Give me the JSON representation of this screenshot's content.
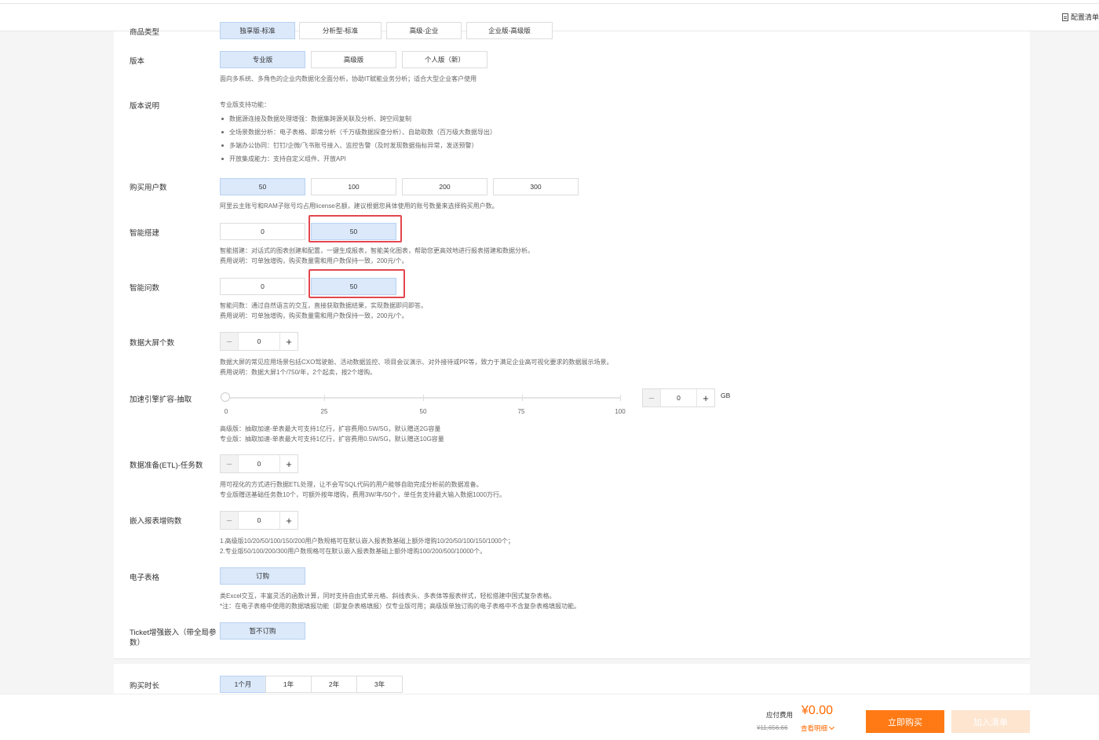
{
  "topbar": {
    "config_label": "配置清单"
  },
  "config": {
    "product_type": {
      "label": "商品类型",
      "options": [
        "独享版-标准",
        "分析型-标准",
        "高级-企业",
        "企业版-高级版"
      ]
    },
    "edition": {
      "label": "版本",
      "options": [
        "专业版",
        "高级版",
        "个人版（新）"
      ],
      "selected": "专业版",
      "desc": "面向多系统、多角色的企业内数据化全面分析，协助IT赋能业务分析；适合大型企业客户使用"
    },
    "edition_desc": {
      "label": "版本说明",
      "intro": "专业版支持功能：",
      "features": [
        "数据源连接及数据处理增强：数据集跨源关联及分析、跨空间复制",
        "全场景数据分析：电子表格、即席分析（千万级数据探查分析）、自助取数（百万级大数据导出）",
        "多端办公协同：钉钉/企微/飞书账号接入、监控告警（及时发现数据指标异常，发送预警）",
        "开放集成能力：支持自定义组件、开放API"
      ]
    },
    "users": {
      "label": "购买用户数",
      "options": [
        "50",
        "100",
        "200",
        "300"
      ],
      "selected": "50",
      "desc": "阿里云主账号和RAM子账号均占用license名额，建议根据您具体使用的账号数量来选择购买用户数。"
    },
    "smart_build": {
      "label": "智能搭建",
      "options": [
        "0",
        "50"
      ],
      "selected": "50",
      "desc1": "智能搭建：对话式的图表创建和配置，一键生成报表，智能美化图表，帮助您更高效地进行报表搭建和数据分析。",
      "desc2": "费用说明：可单独增购，购买数量需和用户数保持一致，200元/个。"
    },
    "smart_qa": {
      "label": "智能问数",
      "options": [
        "0",
        "50"
      ],
      "selected": "50",
      "desc1": "智能问数：通过自然语言的交互，直接获取数据结果，实现数据即问即答。",
      "desc2": "费用说明：可单独增购，购买数量需和用户数保持一致，200元/个。"
    },
    "big_screen": {
      "label": "数据大屏个数",
      "value": "0",
      "desc1": "数据大屏的常见应用场景包括CXO驾驶舱、活动数据监控、项目会议演示、对外接待或PR等，致力于满足企业高可视化要求的数据展示场景。",
      "desc2": "费用说明：数据大屏1个/750/年，2个起卖，按2个增购。"
    },
    "engine": {
      "label": "加速引擎扩容-抽取",
      "slider_value": 0,
      "ticks": [
        "0",
        "25",
        "50",
        "75",
        "100"
      ],
      "value": "0",
      "unit": "GB",
      "desc1": "高级版：抽取加速-单表最大可支持1亿行，扩容费用0.5W/5G，默认赠送2G容量",
      "desc2": "专业版：抽取加速-单表最大可支持1亿行，扩容费用0.5W/5G，默认赠送10G容量"
    },
    "etl": {
      "label": "数据准备(ETL)-任务数",
      "value": "0",
      "desc1": "用可视化的方式进行数据ETL处理，让不会写SQL代码的用户能够自助完成分析前的数据准备。",
      "desc2": "专业版赠送基础任务数10个，可额外按年增购，费用3W/年/50个，单任务支持最大输入数据1000万行。"
    },
    "embed": {
      "label": "嵌入报表增购数",
      "value": "0",
      "desc1": "1.高级版10/20/50/100/150/200用户数规格可在默认嵌入报表数基础上额外增购10/20/50/100/150/1000个；",
      "desc2": "2.专业版50/100/200/300用户数规格可在默认嵌入报表数基础上额外增购100/200/500/10000个。"
    },
    "spreadsheet": {
      "label": "电子表格",
      "option": "订购",
      "desc1": "类Excel交互，丰富灵活的函数计算，同时支持自由式单元格、斜线表头、多表体等报表样式，轻松搭建中国式复杂表格。",
      "desc2": "*注：在电子表格中使用的数据填报功能（即复杂表格填报）仅专业版可用；高级版单独订购的电子表格中不含复杂表格填报功能。"
    },
    "ticket": {
      "label": "Ticket增强嵌入（带全局参数）",
      "option": "暂不订购"
    }
  },
  "duration": {
    "label": "购买时长",
    "options": [
      "1个月",
      "1年",
      "2年",
      "3年"
    ],
    "selected": "1个月"
  },
  "footer": {
    "fee_label": "应付费用",
    "price": "¥0.00",
    "original": "¥11,656.66",
    "detail": "查看明细",
    "buy": "立即购买",
    "cart": "加入清单"
  },
  "colors": {
    "accent": "#ff7a14",
    "selected_bg": "#dbe9fb",
    "highlight": "#e2474f"
  }
}
